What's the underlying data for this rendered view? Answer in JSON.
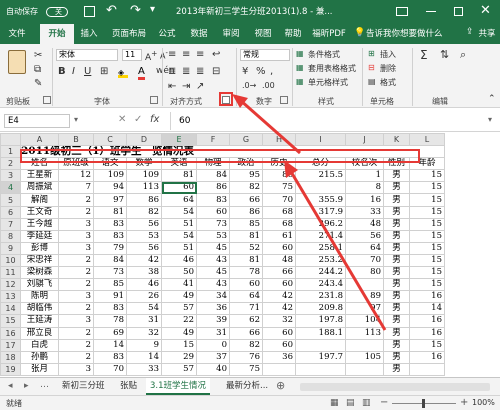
{
  "titlebar": {
    "autosave": "自动保存",
    "autosave_toggle": "关",
    "title": "2013年新初三学生分班2013(1).8 - 兼..."
  },
  "ribbon_tabs": [
    {
      "label": "文件"
    },
    {
      "label": "开始"
    },
    {
      "label": "插入"
    },
    {
      "label": "页面布局"
    },
    {
      "label": "公式"
    },
    {
      "label": "数据"
    },
    {
      "label": "审阅"
    },
    {
      "label": "视图"
    },
    {
      "label": "帮助"
    },
    {
      "label": "福昕PDF"
    },
    {
      "label": "告诉我你想要做什么"
    },
    {
      "label": "共享"
    }
  ],
  "ribbon": {
    "font_name": "宋体",
    "font_size": "11",
    "number_format": "常规",
    "cond_format": "条件格式",
    "table_format": "套用表格格式",
    "cell_style": "单元格样式",
    "insert": "插入",
    "delete": "删除",
    "format": "格式",
    "groups": {
      "clipboard": "剪贴板",
      "font": "字体",
      "alignment": "对齐方式",
      "number": "数字",
      "styles": "样式",
      "cells": "单元格",
      "editing": "编辑"
    }
  },
  "formula_bar": {
    "name_box": "E4",
    "fx": "fx",
    "value": "60"
  },
  "columns": [
    "",
    "A",
    "B",
    "C",
    "D",
    "E",
    "F",
    "G",
    "H",
    "I",
    "J",
    "K",
    "L"
  ],
  "sheet": {
    "title_row": "2011级初三（1）班学生一览情况表",
    "headers": [
      "姓名",
      "原班级",
      "语文",
      "数学",
      "英语",
      "物理",
      "政治",
      "历史",
      "总分",
      "校名次",
      "性别",
      "年龄"
    ],
    "rows": [
      [
        "王星新",
        "12",
        "109",
        "109",
        "81",
        "84",
        "95",
        "80",
        "215.5",
        "1",
        "男",
        "15"
      ],
      [
        "周振斌",
        "7",
        "94",
        "113",
        "60",
        "86",
        "82",
        "75",
        "",
        "8",
        "男",
        "15"
      ],
      [
        "解阁",
        "2",
        "97",
        "86",
        "64",
        "83",
        "66",
        "70",
        "355.9",
        "16",
        "男",
        "15"
      ],
      [
        "王文奇",
        "2",
        "81",
        "82",
        "54",
        "60",
        "86",
        "68",
        "317.9",
        "33",
        "男",
        "15"
      ],
      [
        "王今越",
        "3",
        "83",
        "56",
        "51",
        "73",
        "85",
        "68",
        "296.2",
        "48",
        "男",
        "15"
      ],
      [
        "李延廷",
        "3",
        "83",
        "53",
        "54",
        "53",
        "81",
        "61",
        "271.4",
        "56",
        "男",
        "15"
      ],
      [
        "彭博",
        "3",
        "79",
        "56",
        "51",
        "45",
        "52",
        "60",
        "258.1",
        "64",
        "男",
        "15"
      ],
      [
        "宋忠祥",
        "2",
        "84",
        "42",
        "46",
        "43",
        "81",
        "48",
        "253.2",
        "70",
        "男",
        "15"
      ],
      [
        "梁树森",
        "2",
        "73",
        "38",
        "50",
        "45",
        "78",
        "66",
        "244.2",
        "80",
        "男",
        "15"
      ],
      [
        "刘骐飞",
        "2",
        "85",
        "46",
        "41",
        "43",
        "60",
        "60",
        "243.4",
        "",
        "男",
        "15"
      ],
      [
        "陈明",
        "3",
        "91",
        "26",
        "49",
        "34",
        "64",
        "42",
        "231.8",
        "89",
        "男",
        "16"
      ],
      [
        "胡临伟",
        "2",
        "83",
        "54",
        "57",
        "36",
        "71",
        "42",
        "209.8",
        "97",
        "男",
        "14"
      ],
      [
        "王延涛",
        "3",
        "78",
        "31",
        "22",
        "39",
        "62",
        "32",
        "197.8",
        "104",
        "男",
        "16"
      ],
      [
        "邢立良",
        "2",
        "69",
        "32",
        "49",
        "31",
        "66",
        "60",
        "188.1",
        "113",
        "男",
        "16"
      ],
      [
        "白虎",
        "2",
        "14",
        "9",
        "15",
        "0",
        "82",
        "60",
        "",
        "",
        "男",
        "15"
      ],
      [
        "孙鹏",
        "2",
        "83",
        "14",
        "29",
        "37",
        "76",
        "36",
        "197.7",
        "105",
        "男",
        "16"
      ],
      [
        "张月",
        "3",
        "70",
        "33",
        "57",
        "40",
        "75",
        "",
        "",
        "",
        "男",
        ""
      ]
    ]
  },
  "sheet_tabs": [
    {
      "label": "新初三分班"
    },
    {
      "label": "张贴"
    },
    {
      "label": "3.1班学生情况"
    },
    {
      "label": "最新分析..."
    }
  ],
  "status": {
    "ready": "就绪",
    "zoom": "100%"
  },
  "colors": {
    "excel_green": "#217346",
    "annotation_red": "#e53935"
  }
}
